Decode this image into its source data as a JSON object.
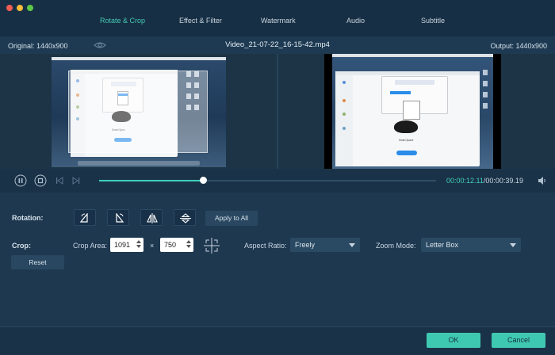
{
  "tabs": [
    {
      "label": "Rotate & Crop",
      "active": true
    },
    {
      "label": "Effect & Filter",
      "active": false
    },
    {
      "label": "Watermark",
      "active": false
    },
    {
      "label": "Audio",
      "active": false
    },
    {
      "label": "Subtitle",
      "active": false
    }
  ],
  "preview": {
    "original_label": "Original: 1440x900",
    "file_name": "Video_21-07-22_16-15-42.mp4",
    "output_label": "Output: 1440x900",
    "left_caption": "Smart Spec",
    "right_caption": "Smart Space"
  },
  "playback": {
    "current_time": "00:00:12.11",
    "separator": "/",
    "total_time": "00:00:39.19",
    "progress": 0.3093
  },
  "rotation": {
    "label": "Rotation:",
    "apply_all_label": "Apply to All"
  },
  "crop": {
    "label": "Crop:",
    "area_label": "Crop Area:",
    "width_value": "1091",
    "times_sign": "×",
    "height_value": "750",
    "aspect_label": "Aspect Ratio:",
    "aspect_value": "Freely",
    "zoom_label": "Zoom Mode:",
    "zoom_value": "Letter Box",
    "reset_label": "Reset"
  },
  "footer": {
    "ok_label": "OK",
    "cancel_label": "Cancel"
  },
  "colors": {
    "accent": "#3fc8b1",
    "background": "#1e3850"
  },
  "icons": [
    "close-icon",
    "minimize-icon",
    "maximize-icon",
    "eye-icon",
    "pause-icon",
    "stop-icon",
    "previous-icon",
    "next-icon",
    "volume-icon",
    "rotate-left-icon",
    "rotate-right-icon",
    "flip-horizontal-icon",
    "flip-vertical-icon",
    "crop-center-icon"
  ]
}
